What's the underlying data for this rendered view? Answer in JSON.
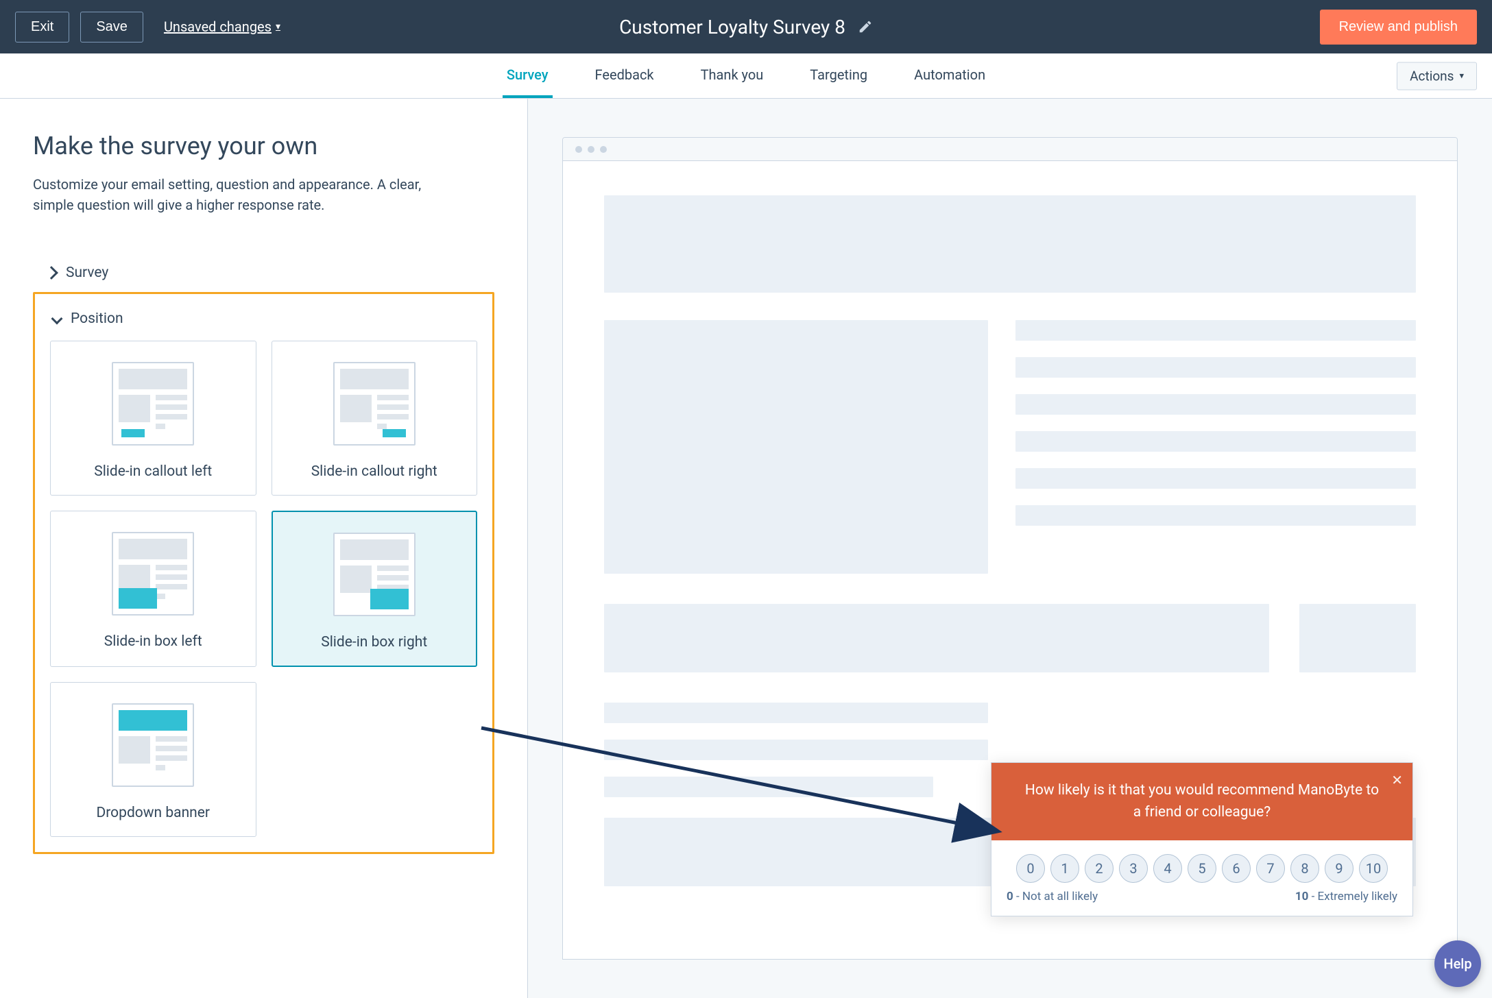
{
  "topbar": {
    "exit": "Exit",
    "save": "Save",
    "unsaved": "Unsaved changes",
    "title": "Customer Loyalty Survey 8",
    "publish": "Review and publish"
  },
  "tabs": {
    "survey": "Survey",
    "feedback": "Feedback",
    "thankyou": "Thank you",
    "targeting": "Targeting",
    "automation": "Automation",
    "actions": "Actions"
  },
  "side": {
    "heading": "Make the survey your own",
    "desc": "Customize your email setting, question and appearance. A clear, simple question will give a higher response rate.",
    "section_survey": "Survey",
    "section_position": "Position",
    "options": {
      "callout_left": "Slide-in callout left",
      "callout_right": "Slide-in callout right",
      "box_left": "Slide-in box left",
      "box_right": "Slide-in box right",
      "dropdown_banner": "Dropdown banner"
    }
  },
  "survey_popup": {
    "question": "How likely is it that you would recommend ManoByte to a friend or colleague?",
    "scale": [
      "0",
      "1",
      "2",
      "3",
      "4",
      "5",
      "6",
      "7",
      "8",
      "9",
      "10"
    ],
    "low_label_num": "0",
    "low_label_text": " - Not at all likely",
    "high_label_num": "10",
    "high_label_text": " - Extremely likely"
  },
  "help": "Help"
}
